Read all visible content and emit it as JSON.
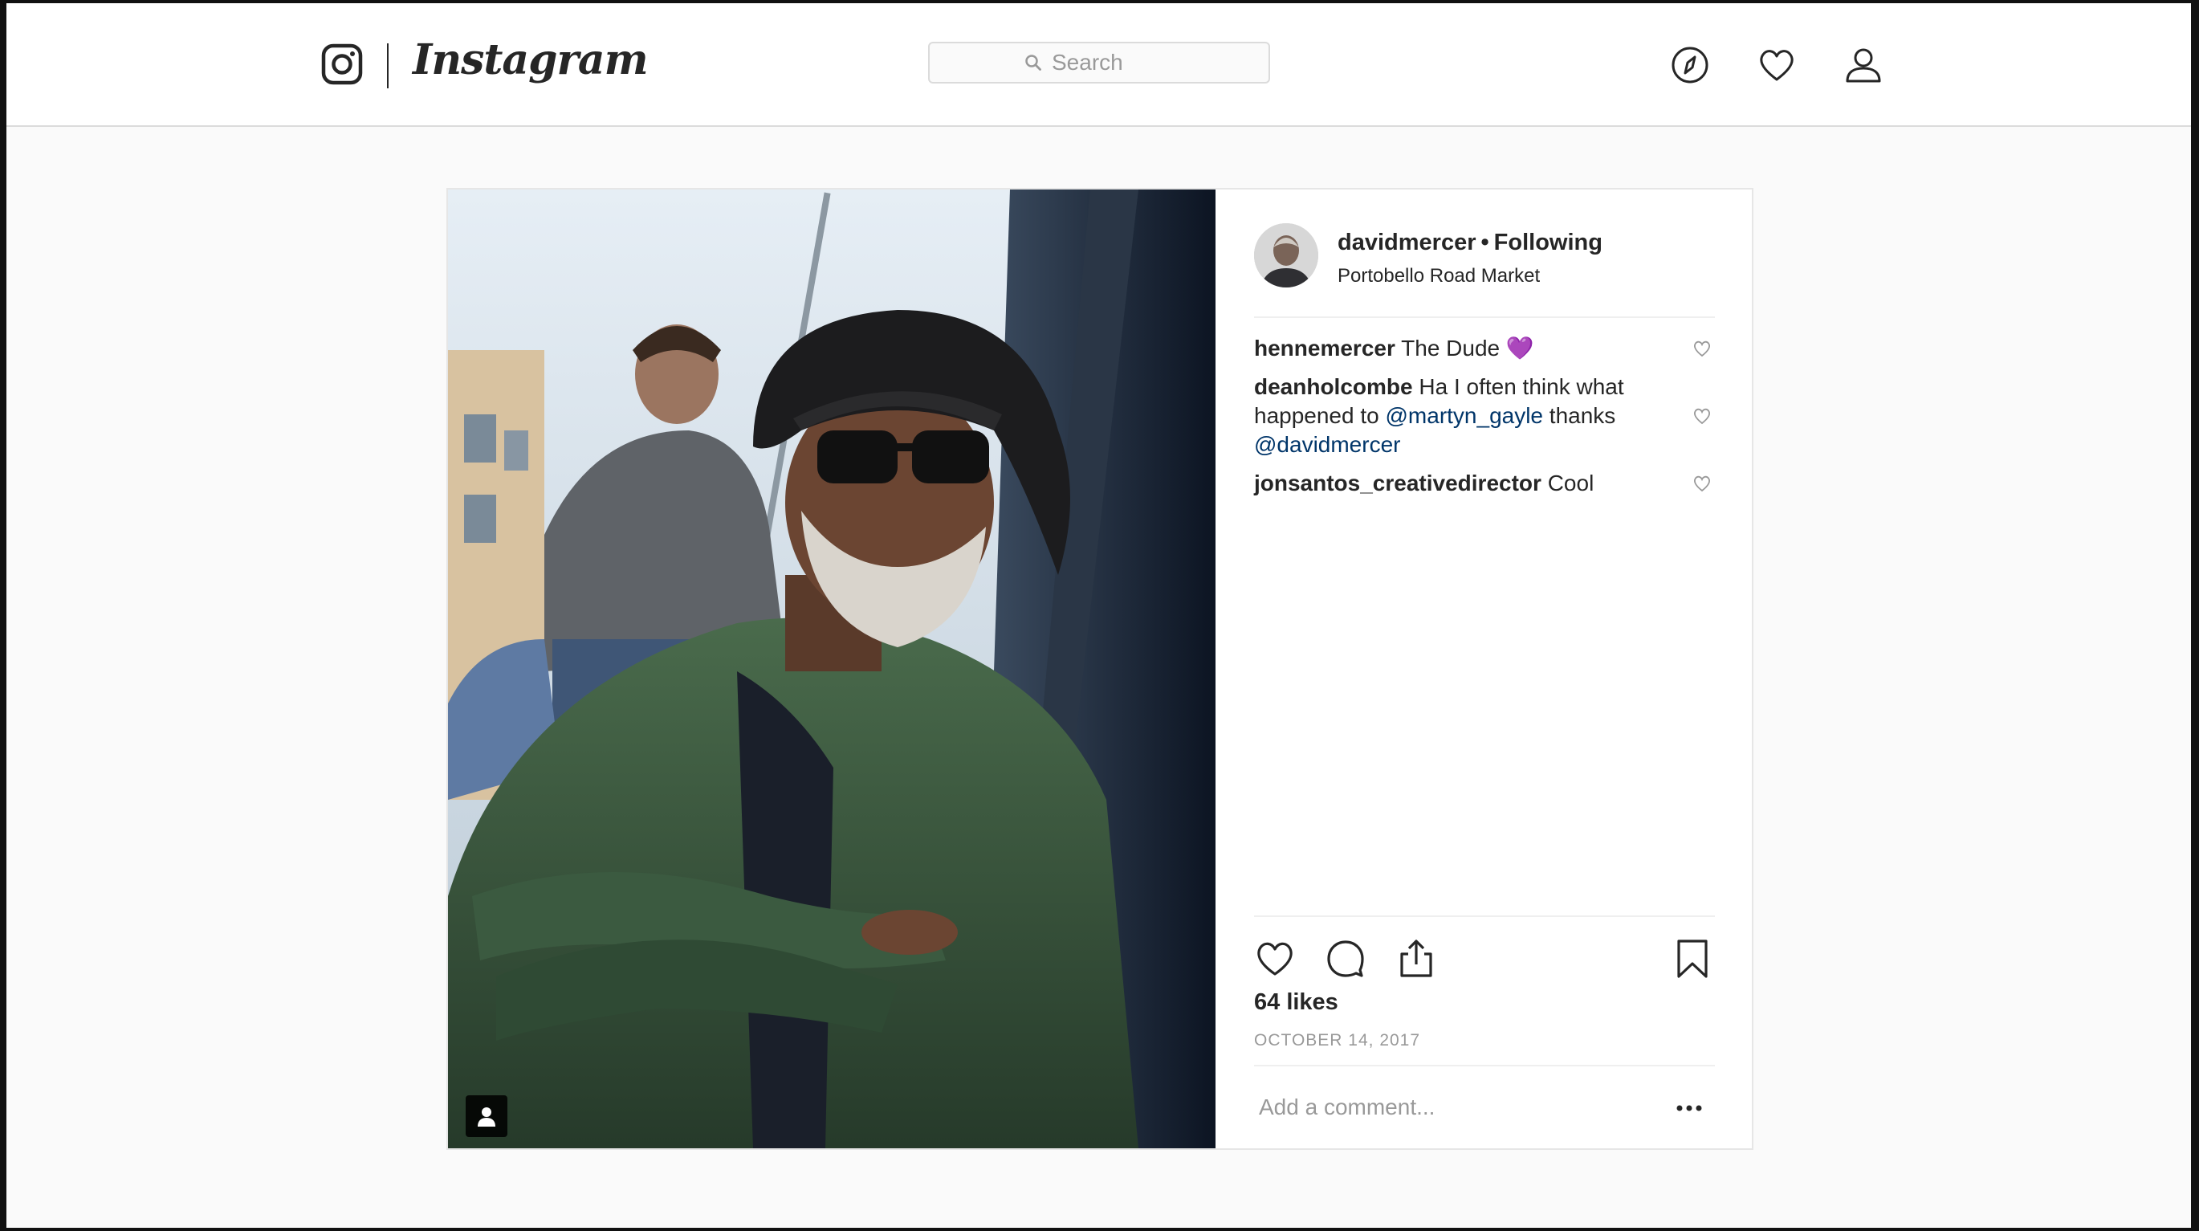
{
  "header": {
    "brand": "Instagram",
    "search_placeholder": "Search"
  },
  "post": {
    "author": {
      "username": "davidmercer",
      "follow_status": "Following",
      "separator": "•",
      "location": "Portobello Road Market"
    },
    "comments": [
      {
        "user": "hennemercer",
        "text": " The Dude ",
        "emoji": "💜"
      },
      {
        "user": "deanholcombe",
        "text_before": " Ha I often think what happened to ",
        "mention1": "@martyn_gayle",
        "text_middle": " thanks ",
        "mention2": "@davidmercer"
      },
      {
        "user": "jonsantos_creativedirector",
        "text": " Cool"
      }
    ],
    "likes": "64 likes",
    "date": "OCTOBER 14, 2017",
    "add_comment_placeholder": "Add a comment..."
  },
  "colors": {
    "text": "#262626",
    "mention": "#003569",
    "muted": "#999999",
    "border": "#dbdbdb",
    "background": "#fafafa"
  },
  "icons": [
    "instagram-glyph-icon",
    "search-icon",
    "explore-compass-icon",
    "heart-icon",
    "profile-icon",
    "comment-icon",
    "share-icon",
    "bookmark-icon",
    "more-options-icon",
    "tagged-user-icon"
  ]
}
